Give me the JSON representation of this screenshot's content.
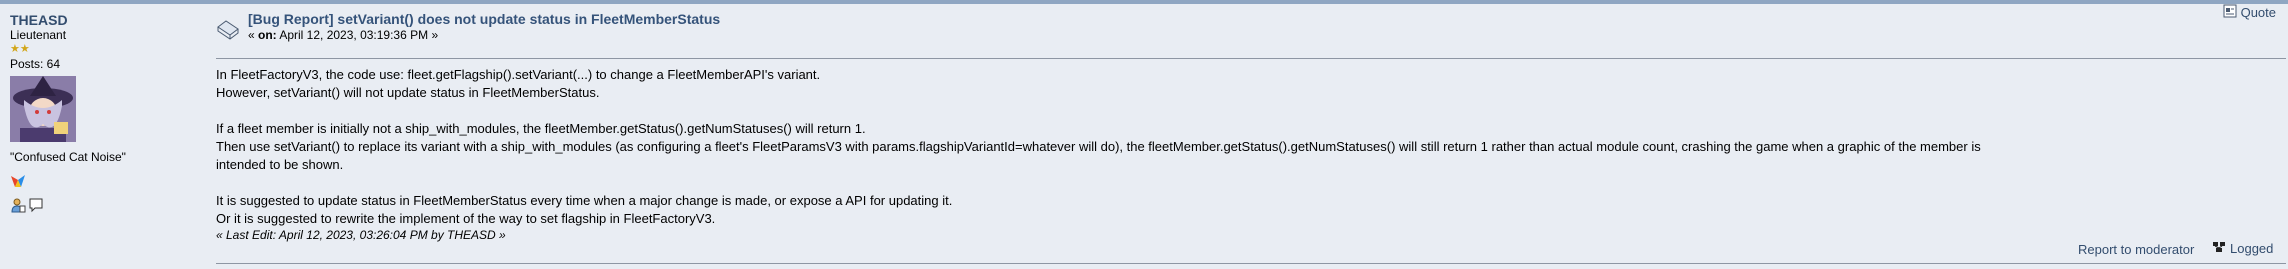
{
  "poster": {
    "name": "THEASD",
    "rank": "Lieutenant",
    "stars": "★★",
    "posts": "Posts: 64",
    "custom_title": "\"Confused Cat Noise\""
  },
  "post": {
    "subject": "[Bug Report] setVariant() does not update status in FleetMemberStatus",
    "date_prefix": "« ",
    "date_on": "on:",
    "date_value": " April 12, 2023, 03:19:36 PM »",
    "quote_label": "Quote",
    "body_lines": [
      "In FleetFactoryV3, the code use: fleet.getFlagship().setVariant(...) to change a FleetMemberAPI's variant.",
      "However, setVariant() will not update status in FleetMemberStatus.",
      "",
      "If a fleet member is initially not a ship_with_modules, the fleetMember.getStatus().getNumStatuses() will return 1.",
      "Then use setVariant() to replace its variant with a ship_with_modules (as configuring a fleet's FleetParamsV3 with params.flagshipVariantId=whatever will do), the fleetMember.getStatus().getNumStatuses() will still return 1 rather than actual module count, crashing the game when a graphic of the member is",
      "intended to be shown.",
      "",
      "It is suggested to update status in FleetMemberStatus every time when a major change is made, or expose a API for updating it.",
      "Or it is suggested to rewrite the implement of the way to set flagship in FleetFactoryV3."
    ],
    "last_edit": "« Last Edit: April 12, 2023, 03:26:04 PM by THEASD »",
    "report_label": "Report to moderator",
    "logged_label": "Logged"
  },
  "colors": {
    "background": "#e9edf3",
    "link": "#334d6e",
    "subject": "#35537a",
    "star": "#d2a61a"
  }
}
